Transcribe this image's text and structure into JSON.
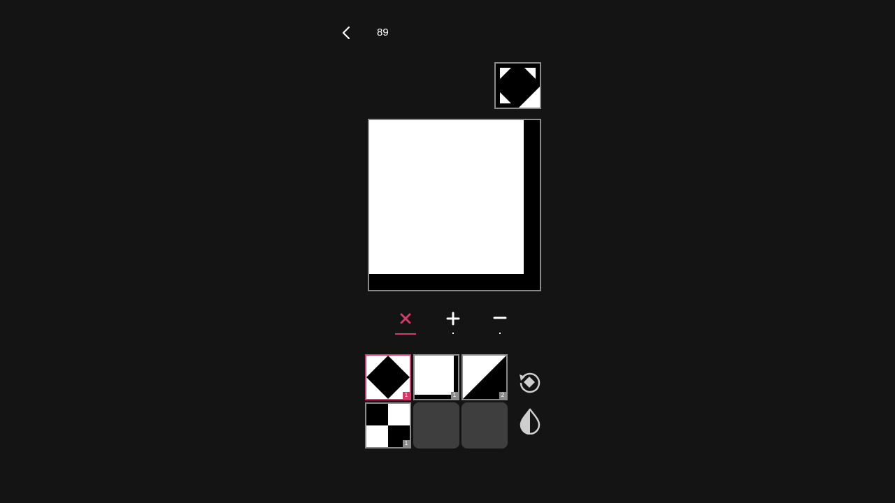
{
  "level": "89",
  "operations": [
    {
      "name": "multiply",
      "symbol": "×",
      "active": true
    },
    {
      "name": "add",
      "symbol": "+",
      "active": false
    },
    {
      "name": "subtract",
      "symbol": "−",
      "active": false
    }
  ],
  "tiles": [
    {
      "name": "diamond",
      "count": "1",
      "selected": true
    },
    {
      "name": "corner-bracket",
      "count": "1",
      "selected": false
    },
    {
      "name": "diagonal-triangle",
      "count": "2",
      "selected": false
    },
    {
      "name": "checker",
      "count": "1",
      "selected": false
    }
  ],
  "icons": {
    "back": "chevron-left-icon",
    "rotate": "rotate-icon",
    "invert": "invert-drop-icon"
  },
  "colors": {
    "background": "#141414",
    "accent": "#d33a6a",
    "border": "#8a8a8a",
    "empty_slot": "#3e3e3e"
  }
}
